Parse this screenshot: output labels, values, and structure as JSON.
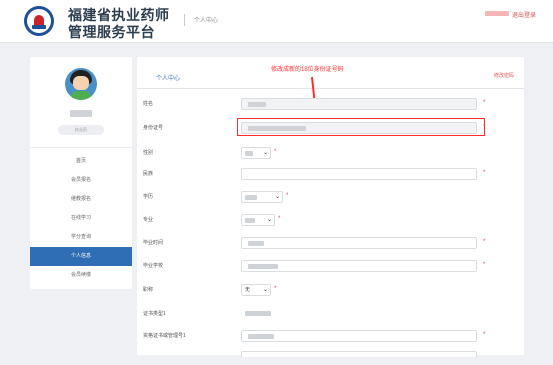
{
  "header": {
    "brand_line1": "福建省执业药师",
    "brand_line2": "管理服务平台",
    "breadcrumb": "个人中心",
    "logout": "退出登录"
  },
  "sidebar": {
    "user_tag": "执业药",
    "nav": [
      "首页",
      "会员报名",
      "继教报名",
      "在线学习",
      "学分查询",
      "个人信息",
      "会员续缴"
    ],
    "active_index": 5
  },
  "main": {
    "title": "个人中心",
    "change_password": "修改密码",
    "annotation": "修改成新的18位身份证号码",
    "fields": {
      "name": "姓名",
      "id_card": "身份证号",
      "gender": "性别",
      "ethnicity": "民族",
      "education": "学历",
      "major": "专业",
      "grad_time": "毕业时间",
      "school": "毕业学校",
      "title": "职称",
      "title_value": "无",
      "cert_type": "证书类型1",
      "cert_no": "资格证书或管理号1"
    }
  },
  "colors": {
    "accent": "#2f6db5",
    "annotation": "#ff2d2d",
    "required": "#ee3333"
  }
}
